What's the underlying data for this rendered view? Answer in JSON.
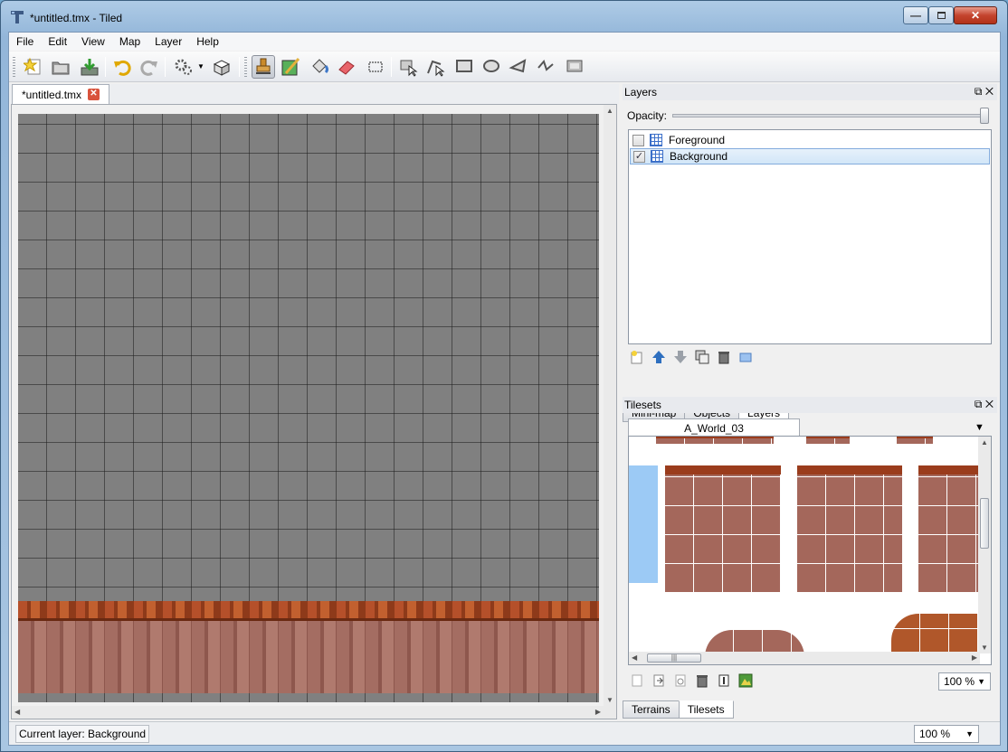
{
  "window": {
    "title": "*untitled.tmx - Tiled"
  },
  "menu": [
    "File",
    "Edit",
    "View",
    "Map",
    "Layer",
    "Help"
  ],
  "document_tab": {
    "label": "*untitled.tmx"
  },
  "layers_panel": {
    "title": "Layers",
    "opacity_label": "Opacity:",
    "opacity_percent": 100,
    "layers": [
      {
        "name": "Foreground",
        "visible": false,
        "selected": false
      },
      {
        "name": "Background",
        "visible": true,
        "selected": true
      }
    ]
  },
  "upper_tabs": [
    "Mini-map",
    "Objects",
    "Layers"
  ],
  "tilesets_panel": {
    "title": "Tilesets",
    "tileset_name": "A_World_03",
    "zoom": "100 %"
  },
  "lower_tabs": [
    "Terrains",
    "Tilesets"
  ],
  "status": {
    "current_layer": "Current layer: Background",
    "zoom": "100 %"
  },
  "icons": {
    "toolbar": [
      "new-map-icon",
      "open-file-icon",
      "save-icon",
      "undo-icon",
      "redo-icon",
      "commands-icon",
      "random-mode-icon",
      "stamp-brush-icon",
      "terrain-brush-icon",
      "bucket-fill-icon",
      "eraser-icon",
      "rect-select-icon",
      "select-objects-icon",
      "edit-polygons-icon",
      "insert-rectangle-icon",
      "insert-ellipse-icon",
      "insert-polygon-icon",
      "insert-polyline-icon",
      "insert-tile-icon"
    ]
  }
}
